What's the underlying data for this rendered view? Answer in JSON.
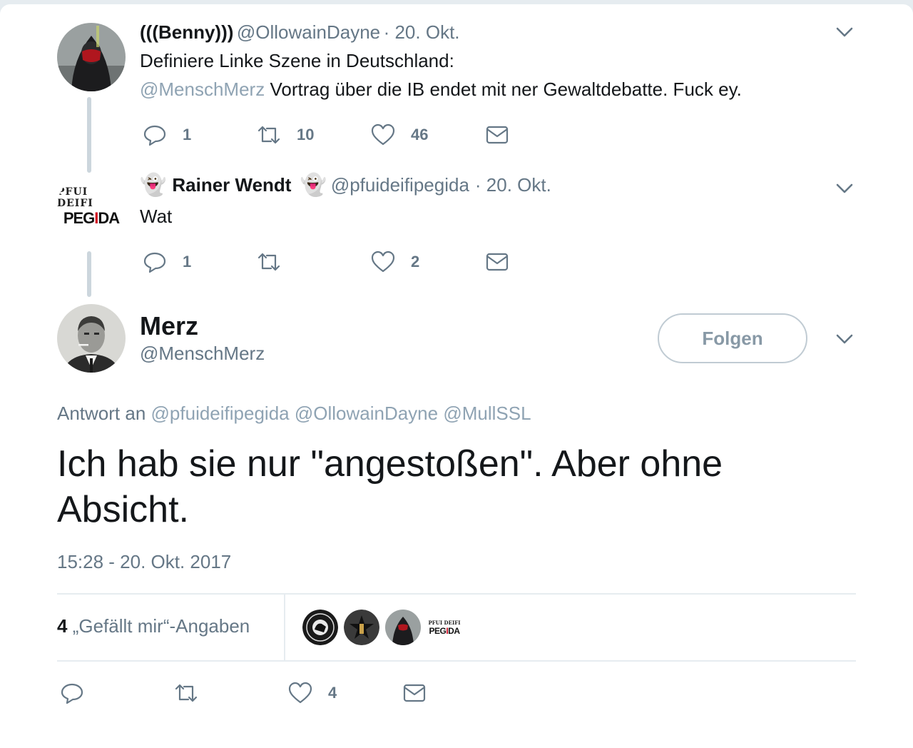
{
  "tweets": [
    {
      "display_name": "(((Benny)))",
      "handle": "@OllowainDayne",
      "date": "· 20. Okt.",
      "text_line1": "Definiere Linke Szene in Deutschland:",
      "mention": "@MenschMerz",
      "text_line2": "Vortrag über die IB endet mit ner Gewaltdebatte. Fuck ey.",
      "replies": "1",
      "retweets": "10",
      "likes": "46"
    },
    {
      "emoji_left": "👻",
      "display_name": "Rainer Wendt",
      "emoji_right": "👻",
      "handle": "@pfuideifipegida",
      "date": "· 20. Okt.",
      "text": "Wat",
      "replies": "1",
      "retweets": "",
      "likes": "2",
      "avatar_top": "PFUI DEIFI",
      "avatar_main_a": "PEG",
      "avatar_main_b": "I",
      "avatar_main_c": "DA"
    }
  ],
  "main_tweet": {
    "display_name": "Merz",
    "handle": "@MenschMerz",
    "follow_label": "Folgen",
    "reply_to_label": "Antwort an",
    "reply_to_handles": "@pfuideifipegida @OllowainDayne @MullSSL",
    "text": "Ich hab sie nur \"angestoßen\". Aber ohne Absicht.",
    "timestamp": "15:28 - 20. Okt. 2017",
    "likes_count": "4",
    "likes_label": "„Gefällt mir“-Angaben",
    "action_likes": "4",
    "liker_logo_top": "PFUI DEIFI",
    "liker_logo_a": "PEG",
    "liker_logo_b": "I",
    "liker_logo_c": "DA"
  },
  "colors": {
    "text": "#14171a",
    "secondary": "#657786",
    "mention": "#8fa3b3",
    "border": "#e6ecf0",
    "accent_red": "#d0021b"
  },
  "icons": [
    "reply-icon",
    "retweet-icon",
    "like-icon",
    "dm-icon",
    "chevron-down-icon"
  ]
}
